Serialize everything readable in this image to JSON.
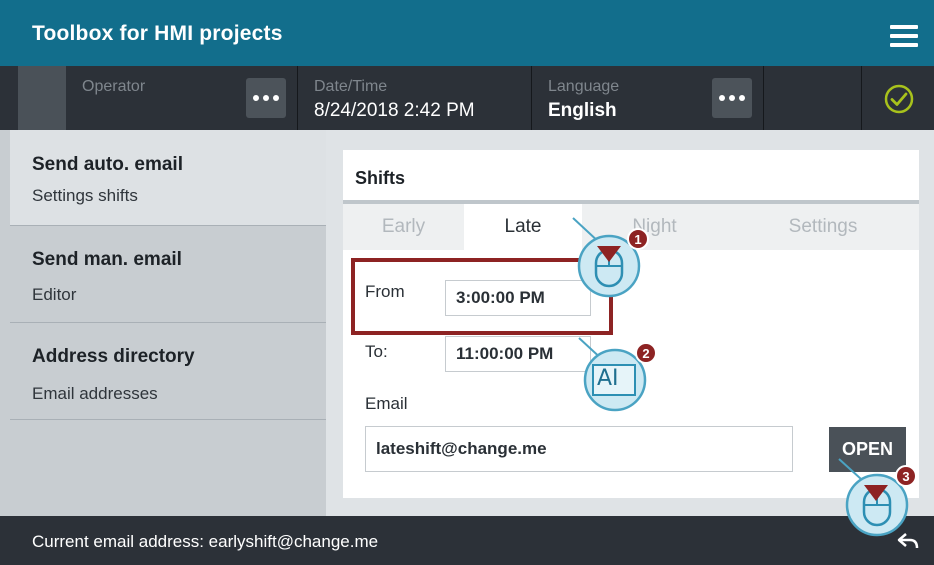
{
  "header": {
    "title": "Toolbox for HMI projects"
  },
  "status_bar": {
    "operator_label": "Operator",
    "datetime_label": "Date/Time",
    "datetime_value": "8/24/2018 2:42 PM",
    "language_label": "Language",
    "language_value": "English"
  },
  "sidebar": {
    "items": [
      {
        "title": "Send auto. email",
        "subtitle": "Settings shifts"
      },
      {
        "title": "Send man. email",
        "subtitle": "Editor"
      },
      {
        "title": "Address directory",
        "subtitle": "Email addresses"
      }
    ]
  },
  "panel": {
    "title": "Shifts",
    "tabs": [
      "Early",
      "Late",
      "Night",
      "Settings"
    ],
    "active_tab": "Late",
    "from_label": "From",
    "from_value": "3:00:00 PM",
    "to_label": "To:",
    "to_value": "11:00:00 PM",
    "email_label": "Email",
    "email_value": "lateshift@change.me",
    "open_button": "OPEN"
  },
  "footer": {
    "text": "Current email address: earlyshift@change.me"
  },
  "callouts": [
    {
      "number": "1",
      "icon": "mouse-click-icon"
    },
    {
      "number": "2",
      "icon": "text-input-icon",
      "glyph": "AI"
    },
    {
      "number": "3",
      "icon": "mouse-click-icon"
    }
  ],
  "colors": {
    "header": "#126e8c",
    "dark_bar": "#2c3138",
    "highlight": "#8d2323",
    "check": "#a8c21c",
    "callout_fill": "#cde9f3",
    "callout_stroke": "#4aa3c3"
  }
}
